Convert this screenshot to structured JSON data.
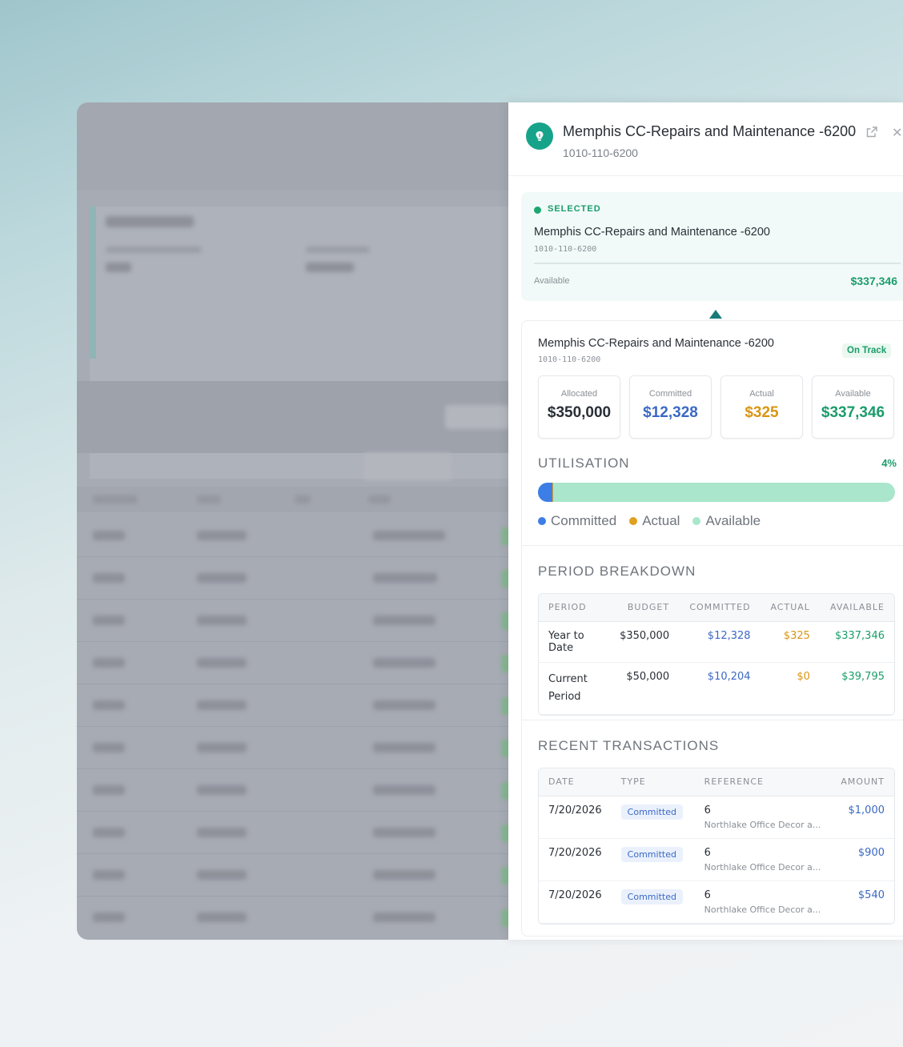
{
  "panel": {
    "title": "Memphis CC-Repairs and Maintenance -6200",
    "code": "1010-110-6200"
  },
  "selected": {
    "label": "SELECTED",
    "title": "Memphis CC-Repairs and Maintenance -6200",
    "code": "1010-110-6200",
    "available_label": "Available",
    "available_value": "$337,346"
  },
  "detail": {
    "title": "Memphis CC-Repairs and Maintenance -6200",
    "code": "1010-110-6200",
    "status": "On Track",
    "stats": [
      {
        "label": "Allocated",
        "value": "$350,000",
        "color": "#2a2f36"
      },
      {
        "label": "Committed",
        "value": "$12,328",
        "color": "#3b68c4"
      },
      {
        "label": "Actual",
        "value": "$325",
        "color": "#d99513"
      },
      {
        "label": "Available",
        "value": "$337,346",
        "color": "#1a9c6b"
      }
    ]
  },
  "utilisation": {
    "title": "UTILISATION",
    "percent": "4%",
    "committed_fraction": 0.035,
    "actual_fraction": 0.001,
    "legend": {
      "committed": "Committed",
      "actual": "Actual",
      "available": "Available"
    },
    "colors": {
      "committed": "#3d7ee6",
      "actual": "#e0a020",
      "available": "#a9e6cc"
    }
  },
  "period_breakdown": {
    "title": "PERIOD BREAKDOWN",
    "headers": [
      "PERIOD",
      "BUDGET",
      "COMMITTED",
      "ACTUAL",
      "AVAILABLE"
    ],
    "rows": [
      {
        "period": "Year to Date",
        "budget": "$350,000",
        "committed": "$12,328",
        "actual": "$325",
        "available": "$337,346"
      },
      {
        "period": "Current Period",
        "budget": "$50,000",
        "committed": "$10,204",
        "actual": "$0",
        "available": "$39,795"
      }
    ]
  },
  "recent_transactions": {
    "title": "RECENT TRANSACTIONS",
    "headers": [
      "DATE",
      "TYPE",
      "REFERENCE",
      "AMOUNT"
    ],
    "rows": [
      {
        "date": "7/20/2026",
        "type": "Committed",
        "ref": "6",
        "ref_desc": "Northlake Office Decor a...",
        "amount": "$1,000"
      },
      {
        "date": "7/20/2026",
        "type": "Committed",
        "ref": "6",
        "ref_desc": "Northlake Office Decor a...",
        "amount": "$900"
      },
      {
        "date": "7/20/2026",
        "type": "Committed",
        "ref": "6",
        "ref_desc": "Northlake Office Decor a...",
        "amount": "$540"
      }
    ]
  },
  "icons": {
    "logo": "lightbulb-icon",
    "external": "external-link-icon",
    "close": "close-icon"
  }
}
